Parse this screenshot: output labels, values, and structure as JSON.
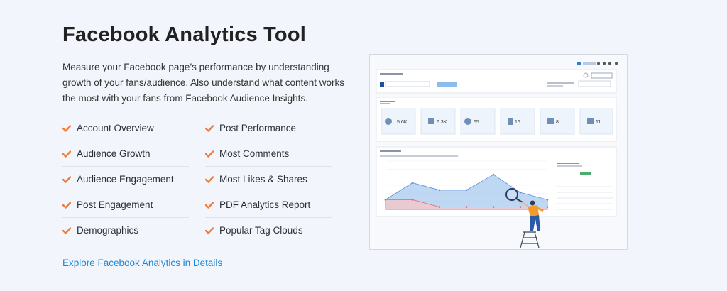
{
  "title": "Facebook Analytics Tool",
  "description": "Measure your Facebook page’s performance by understanding growth of your fans/audience. Also understand what content works the most with your fans from Facebook Audience Insights.",
  "features_left": [
    "Account Overview",
    "Audience Growth",
    "Audience Engagement",
    "Post Engagement",
    "Demographics"
  ],
  "features_right": [
    "Post Performance",
    "Most Comments",
    "Most Likes & Shares",
    "PDF Analytics Report",
    "Popular Tag Clouds"
  ],
  "explore_link": "Explore Facebook Analytics in Details",
  "colors": {
    "accent_check": "#f07d3a",
    "link": "#1e87d8",
    "chart_blue": "#a8c9ef",
    "chart_red": "#f6c6c4"
  },
  "screenshot": {
    "chart_data": {
      "type": "area",
      "series": [
        {
          "values": [
            0.2,
            0.55,
            0.4,
            0.4,
            0.72,
            0.35,
            0.2
          ]
        },
        {
          "values": [
            0.2,
            0.2,
            0.05,
            0.05,
            0.05,
            0.05,
            0.05
          ]
        }
      ],
      "ylim": [
        0,
        1
      ]
    }
  }
}
